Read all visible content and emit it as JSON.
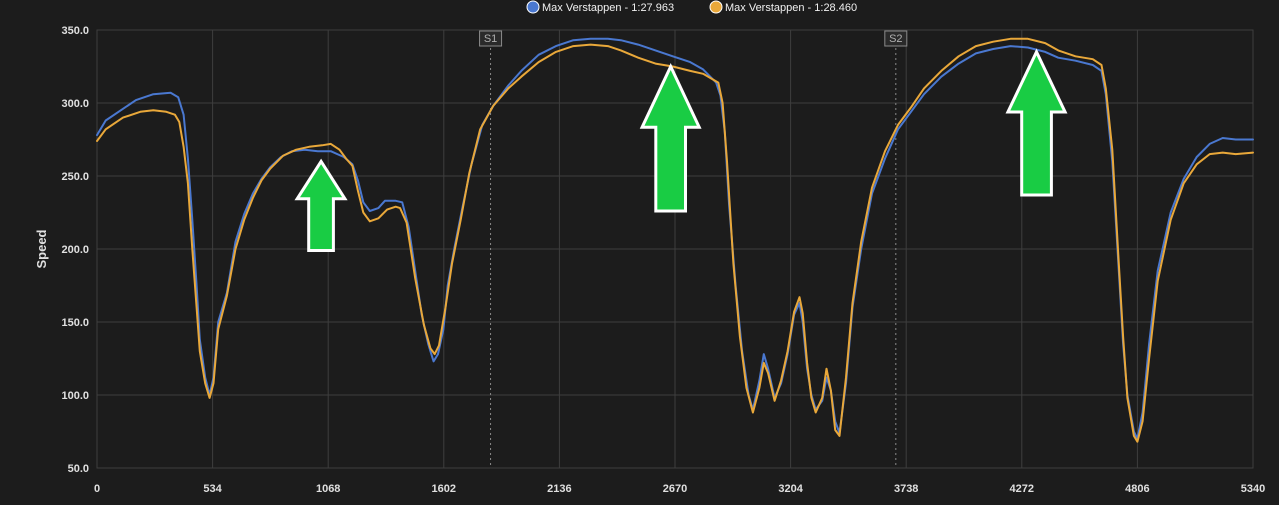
{
  "chart_data": {
    "type": "line",
    "title": "",
    "xlabel": "",
    "ylabel": "Speed",
    "xlim": [
      0,
      5340
    ],
    "ylim": [
      50,
      350
    ],
    "x_ticks": [
      0,
      534,
      1068,
      1602,
      2136,
      2670,
      3204,
      3738,
      4272,
      4806,
      5340
    ],
    "y_ticks": [
      "350.0",
      "300.0",
      "250.0",
      "200.0",
      "150.0",
      "100.0",
      "50.0"
    ],
    "y_tick_values": [
      350,
      300,
      250,
      200,
      150,
      100,
      50
    ],
    "grid": true,
    "legend_position": "top",
    "sector_markers": [
      {
        "label": "S1",
        "x": 1818
      },
      {
        "label": "S2",
        "x": 3690
      }
    ],
    "series": [
      {
        "name": "Max Verstappen - 1:27.963",
        "color": "#4a78d0",
        "points": [
          [
            0,
            278
          ],
          [
            40,
            288
          ],
          [
            120,
            296
          ],
          [
            180,
            302
          ],
          [
            260,
            306
          ],
          [
            340,
            307
          ],
          [
            375,
            304
          ],
          [
            400,
            292
          ],
          [
            420,
            262
          ],
          [
            440,
            220
          ],
          [
            460,
            175
          ],
          [
            475,
            138
          ],
          [
            500,
            112
          ],
          [
            520,
            100
          ],
          [
            538,
            112
          ],
          [
            560,
            150
          ],
          [
            600,
            170
          ],
          [
            640,
            205
          ],
          [
            680,
            224
          ],
          [
            720,
            238
          ],
          [
            760,
            248
          ],
          [
            800,
            256
          ],
          [
            850,
            263
          ],
          [
            900,
            267
          ],
          [
            960,
            268
          ],
          [
            1020,
            267
          ],
          [
            1080,
            267
          ],
          [
            1140,
            263
          ],
          [
            1180,
            258
          ],
          [
            1205,
            247
          ],
          [
            1230,
            232
          ],
          [
            1260,
            226
          ],
          [
            1300,
            228
          ],
          [
            1330,
            233
          ],
          [
            1380,
            233
          ],
          [
            1410,
            232
          ],
          [
            1440,
            215
          ],
          [
            1470,
            185
          ],
          [
            1500,
            155
          ],
          [
            1530,
            135
          ],
          [
            1555,
            123
          ],
          [
            1575,
            128
          ],
          [
            1600,
            145
          ],
          [
            1620,
            175
          ],
          [
            1650,
            200
          ],
          [
            1690,
            230
          ],
          [
            1730,
            258
          ],
          [
            1780,
            285
          ],
          [
            1830,
            298
          ],
          [
            1900,
            312
          ],
          [
            1960,
            322
          ],
          [
            2040,
            333
          ],
          [
            2120,
            339
          ],
          [
            2200,
            343
          ],
          [
            2280,
            344
          ],
          [
            2360,
            344
          ],
          [
            2420,
            343
          ],
          [
            2500,
            340
          ],
          [
            2580,
            336
          ],
          [
            2660,
            332
          ],
          [
            2740,
            328
          ],
          [
            2800,
            323
          ],
          [
            2860,
            314
          ],
          [
            2880,
            305
          ],
          [
            2900,
            280
          ],
          [
            2920,
            230
          ],
          [
            2950,
            175
          ],
          [
            2980,
            130
          ],
          [
            3010,
            100
          ],
          [
            3030,
            90
          ],
          [
            3060,
            110
          ],
          [
            3080,
            128
          ],
          [
            3100,
            118
          ],
          [
            3130,
            98
          ],
          [
            3160,
            108
          ],
          [
            3190,
            128
          ],
          [
            3220,
            155
          ],
          [
            3245,
            163
          ],
          [
            3260,
            150
          ],
          [
            3280,
            118
          ],
          [
            3300,
            100
          ],
          [
            3320,
            90
          ],
          [
            3350,
            96
          ],
          [
            3370,
            112
          ],
          [
            3390,
            103
          ],
          [
            3410,
            82
          ],
          [
            3430,
            74
          ],
          [
            3460,
            108
          ],
          [
            3490,
            160
          ],
          [
            3530,
            200
          ],
          [
            3580,
            238
          ],
          [
            3640,
            262
          ],
          [
            3700,
            282
          ],
          [
            3760,
            294
          ],
          [
            3820,
            306
          ],
          [
            3900,
            318
          ],
          [
            3980,
            327
          ],
          [
            4060,
            334
          ],
          [
            4140,
            337
          ],
          [
            4220,
            339
          ],
          [
            4300,
            338
          ],
          [
            4380,
            335
          ],
          [
            4440,
            331
          ],
          [
            4520,
            329
          ],
          [
            4600,
            326
          ],
          [
            4640,
            322
          ],
          [
            4660,
            306
          ],
          [
            4690,
            260
          ],
          [
            4720,
            185
          ],
          [
            4740,
            135
          ],
          [
            4760,
            100
          ],
          [
            4790,
            75
          ],
          [
            4806,
            70
          ],
          [
            4830,
            88
          ],
          [
            4860,
            135
          ],
          [
            4900,
            185
          ],
          [
            4960,
            225
          ],
          [
            5020,
            248
          ],
          [
            5080,
            263
          ],
          [
            5140,
            272
          ],
          [
            5200,
            276
          ],
          [
            5260,
            275
          ],
          [
            5340,
            275
          ]
        ]
      },
      {
        "name": "Max Verstappen - 1:28.460",
        "color": "#e9a83a",
        "points": [
          [
            0,
            274
          ],
          [
            40,
            282
          ],
          [
            120,
            290
          ],
          [
            200,
            294
          ],
          [
            260,
            295
          ],
          [
            320,
            294
          ],
          [
            360,
            292
          ],
          [
            380,
            287
          ],
          [
            400,
            270
          ],
          [
            420,
            245
          ],
          [
            440,
            200
          ],
          [
            460,
            160
          ],
          [
            475,
            130
          ],
          [
            500,
            108
          ],
          [
            520,
            98
          ],
          [
            538,
            108
          ],
          [
            560,
            145
          ],
          [
            600,
            168
          ],
          [
            640,
            200
          ],
          [
            680,
            220
          ],
          [
            720,
            235
          ],
          [
            760,
            247
          ],
          [
            800,
            255
          ],
          [
            860,
            264
          ],
          [
            920,
            268
          ],
          [
            980,
            270
          ],
          [
            1040,
            271
          ],
          [
            1080,
            272
          ],
          [
            1120,
            268
          ],
          [
            1150,
            262
          ],
          [
            1180,
            257
          ],
          [
            1205,
            240
          ],
          [
            1230,
            225
          ],
          [
            1260,
            219
          ],
          [
            1300,
            221
          ],
          [
            1340,
            227
          ],
          [
            1380,
            229
          ],
          [
            1400,
            228
          ],
          [
            1430,
            218
          ],
          [
            1470,
            180
          ],
          [
            1510,
            148
          ],
          [
            1540,
            132
          ],
          [
            1560,
            128
          ],
          [
            1580,
            134
          ],
          [
            1610,
            160
          ],
          [
            1640,
            190
          ],
          [
            1680,
            220
          ],
          [
            1720,
            252
          ],
          [
            1770,
            282
          ],
          [
            1830,
            298
          ],
          [
            1900,
            310
          ],
          [
            1960,
            318
          ],
          [
            2040,
            328
          ],
          [
            2120,
            335
          ],
          [
            2200,
            339
          ],
          [
            2280,
            340
          ],
          [
            2360,
            339
          ],
          [
            2420,
            336
          ],
          [
            2500,
            331
          ],
          [
            2580,
            327
          ],
          [
            2660,
            325
          ],
          [
            2740,
            322
          ],
          [
            2800,
            320
          ],
          [
            2870,
            314
          ],
          [
            2890,
            300
          ],
          [
            2910,
            260
          ],
          [
            2940,
            190
          ],
          [
            2970,
            140
          ],
          [
            3000,
            105
          ],
          [
            3030,
            88
          ],
          [
            3060,
            105
          ],
          [
            3080,
            122
          ],
          [
            3100,
            115
          ],
          [
            3130,
            96
          ],
          [
            3160,
            110
          ],
          [
            3190,
            130
          ],
          [
            3220,
            157
          ],
          [
            3245,
            167
          ],
          [
            3260,
            156
          ],
          [
            3280,
            122
          ],
          [
            3300,
            98
          ],
          [
            3320,
            88
          ],
          [
            3350,
            98
          ],
          [
            3370,
            118
          ],
          [
            3390,
            103
          ],
          [
            3410,
            76
          ],
          [
            3430,
            72
          ],
          [
            3460,
            112
          ],
          [
            3490,
            163
          ],
          [
            3530,
            205
          ],
          [
            3580,
            242
          ],
          [
            3640,
            267
          ],
          [
            3700,
            285
          ],
          [
            3760,
            297
          ],
          [
            3820,
            310
          ],
          [
            3900,
            322
          ],
          [
            3980,
            332
          ],
          [
            4060,
            339
          ],
          [
            4140,
            342
          ],
          [
            4220,
            344
          ],
          [
            4300,
            344
          ],
          [
            4380,
            341
          ],
          [
            4440,
            336
          ],
          [
            4520,
            332
          ],
          [
            4600,
            330
          ],
          [
            4640,
            326
          ],
          [
            4660,
            310
          ],
          [
            4690,
            268
          ],
          [
            4720,
            190
          ],
          [
            4740,
            140
          ],
          [
            4760,
            98
          ],
          [
            4790,
            72
          ],
          [
            4806,
            68
          ],
          [
            4830,
            82
          ],
          [
            4860,
            125
          ],
          [
            4900,
            178
          ],
          [
            4960,
            220
          ],
          [
            5020,
            245
          ],
          [
            5080,
            258
          ],
          [
            5140,
            265
          ],
          [
            5200,
            266
          ],
          [
            5260,
            265
          ],
          [
            5340,
            266
          ]
        ]
      }
    ],
    "annotations": [
      {
        "type": "arrow-up",
        "color": "#19cc44",
        "x": 1035,
        "y_top": 260,
        "y_bottom": 199,
        "half_width_data": 110
      },
      {
        "type": "arrow-up",
        "color": "#19cc44",
        "x": 2650,
        "y_top": 325,
        "y_bottom": 226,
        "half_width_data": 132
      },
      {
        "type": "arrow-up",
        "color": "#19cc44",
        "x": 4340,
        "y_top": 335,
        "y_bottom": 237,
        "half_width_data": 132
      }
    ]
  }
}
